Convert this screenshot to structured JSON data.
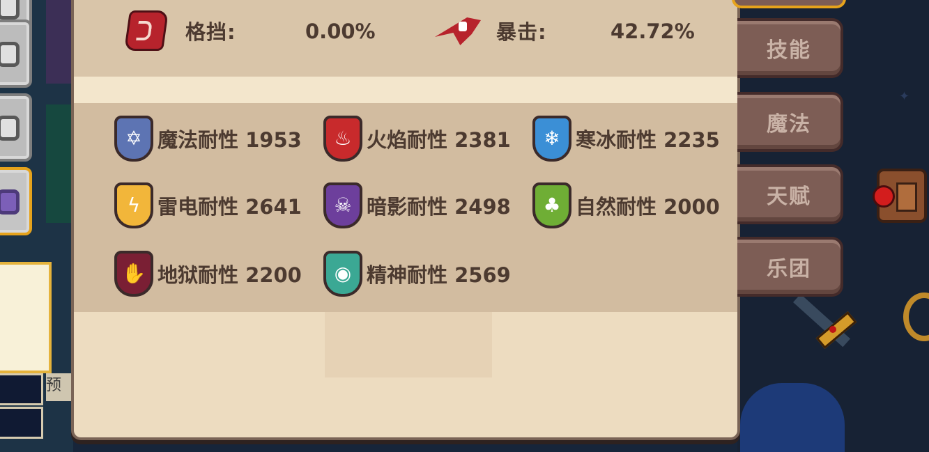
{
  "stats": [
    {
      "label": "格挡:",
      "value": "0.00%",
      "icon": "block-icon"
    },
    {
      "label": "暴击:",
      "value": "42.72%",
      "icon": "crit-icon"
    }
  ],
  "resistances": [
    {
      "label": "魔法耐性 1953",
      "icon": "magic-star-shield-icon",
      "color": "#5d74b3",
      "glyph": "✡"
    },
    {
      "label": "火焰耐性 2381",
      "icon": "fire-shield-icon",
      "color": "#c82a2c",
      "glyph": "♨"
    },
    {
      "label": "寒冰耐性 2235",
      "icon": "ice-snowflake-shield-icon",
      "color": "#3b8fd6",
      "glyph": "❄"
    },
    {
      "label": "雷电耐性 2641",
      "icon": "lightning-shield-icon",
      "color": "#f2b63a",
      "glyph": "ϟ"
    },
    {
      "label": "暗影耐性 2498",
      "icon": "shadow-skull-shield-icon",
      "color": "#6d3f9c",
      "glyph": "☠"
    },
    {
      "label": "自然耐性 2000",
      "icon": "nature-flame-shield-icon",
      "color": "#6fae35",
      "glyph": "♣"
    },
    {
      "label": "地狱耐性 2200",
      "icon": "hell-claw-shield-icon",
      "color": "#7a1f34",
      "glyph": "✋"
    },
    {
      "label": "精神耐性 2569",
      "icon": "spirit-eye-shield-icon",
      "color": "#3ba894",
      "glyph": "◉"
    }
  ],
  "tabs": [
    {
      "label": "技能"
    },
    {
      "label": "魔法"
    },
    {
      "label": "天赋"
    },
    {
      "label": "乐团"
    }
  ],
  "left_panel": {
    "preset_label": "预"
  }
}
